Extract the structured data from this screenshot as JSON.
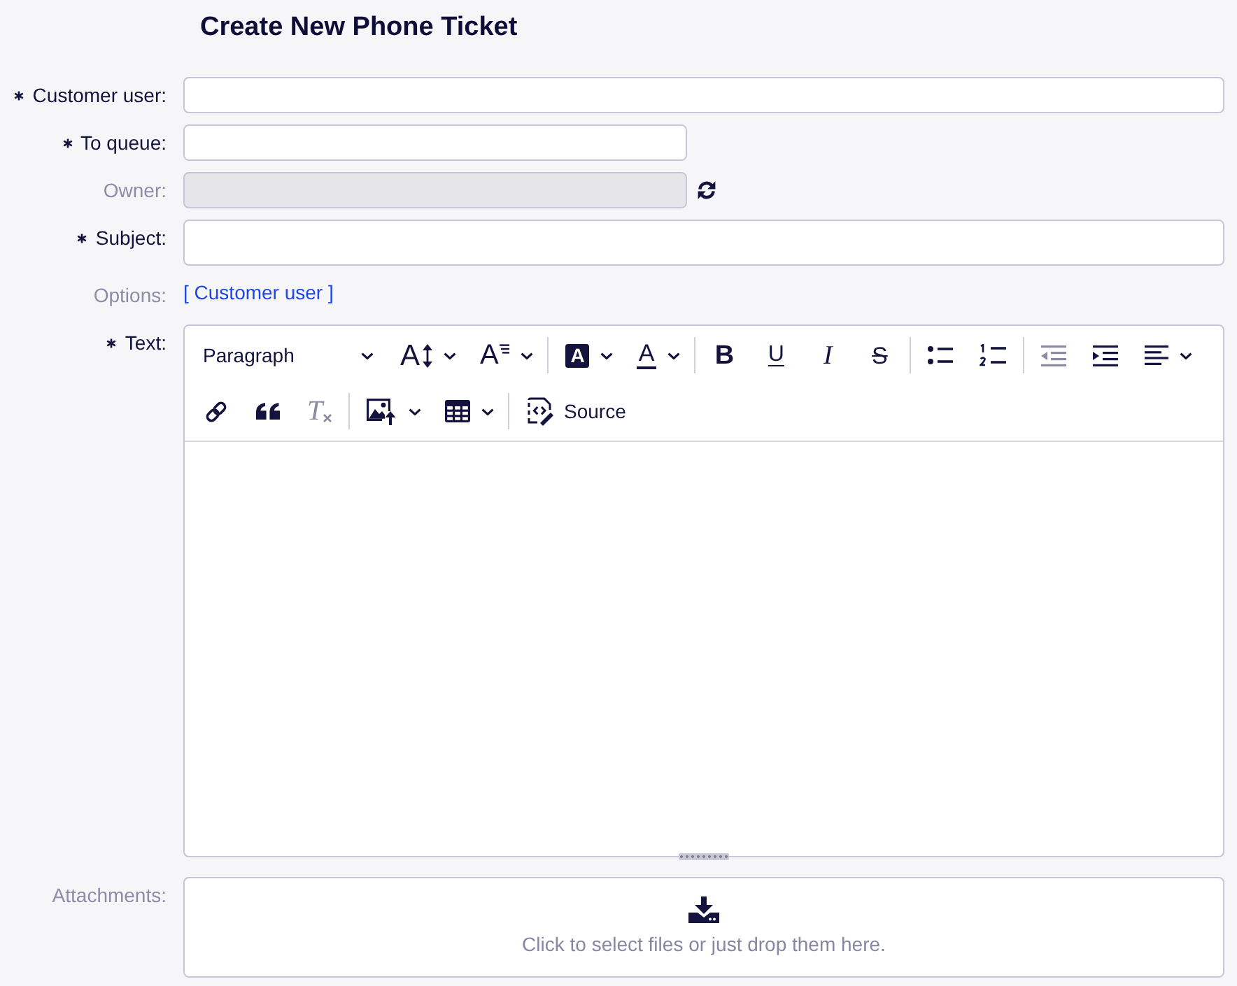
{
  "title": "Create New Phone Ticket",
  "fields": [
    {
      "kind": "autocomplete",
      "label": "Customer user:",
      "required": true,
      "disabled": false,
      "refresh_button": false
    },
    {
      "kind": "select",
      "label": "To queue:",
      "required": true,
      "disabled": false,
      "refresh_button": false
    },
    {
      "kind": "select",
      "label": "Owner:",
      "required": false,
      "disabled": true,
      "refresh_button": true
    },
    {
      "kind": "text",
      "label": "Subject:",
      "required": true,
      "disabled": false,
      "refresh_button": false
    }
  ],
  "options": {
    "label": "Options:",
    "required": false,
    "link": "[ Customer user ]"
  },
  "text": {
    "label": "Text:",
    "required": true,
    "toolbar_rows": [
      {
        "items": [
          {
            "kind": "dropdown",
            "label": "Paragraph",
            "disabled": false
          },
          {
            "kind": "split",
            "glyph": "A",
            "disabled": false
          },
          {
            "kind": "split",
            "glyph": "A",
            "disabled": false
          },
          {
            "kind": "separator"
          },
          {
            "kind": "split",
            "glyph": "A",
            "disabled": false
          },
          {
            "kind": "split",
            "glyph": "A",
            "disabled": false
          },
          {
            "kind": "separator"
          },
          {
            "kind": "button",
            "glyph": "B",
            "disabled": false
          },
          {
            "kind": "button",
            "glyph": "U",
            "disabled": false
          },
          {
            "kind": "button",
            "glyph": "I",
            "disabled": false
          },
          {
            "kind": "button",
            "glyph": "S",
            "disabled": false
          },
          {
            "kind": "separator"
          },
          {
            "kind": "button",
            "disabled": false
          },
          {
            "kind": "button",
            "disabled": false
          },
          {
            "kind": "separator"
          },
          {
            "kind": "button",
            "disabled": true
          },
          {
            "kind": "button",
            "disabled": false
          },
          {
            "kind": "split",
            "disabled": false
          }
        ]
      },
      {
        "items": [
          {
            "kind": "button",
            "disabled": false
          },
          {
            "kind": "button",
            "disabled": false
          },
          {
            "kind": "button",
            "glyph": "T",
            "disabled": true
          },
          {
            "kind": "separator"
          },
          {
            "kind": "split",
            "disabled": false
          },
          {
            "kind": "split",
            "disabled": false
          },
          {
            "kind": "separator"
          },
          {
            "kind": "button",
            "label": "Source",
            "disabled": false
          }
        ]
      }
    ]
  },
  "attachments": {
    "label": "Attachments:",
    "required": false,
    "hint": "Click to select files or just drop them here."
  }
}
